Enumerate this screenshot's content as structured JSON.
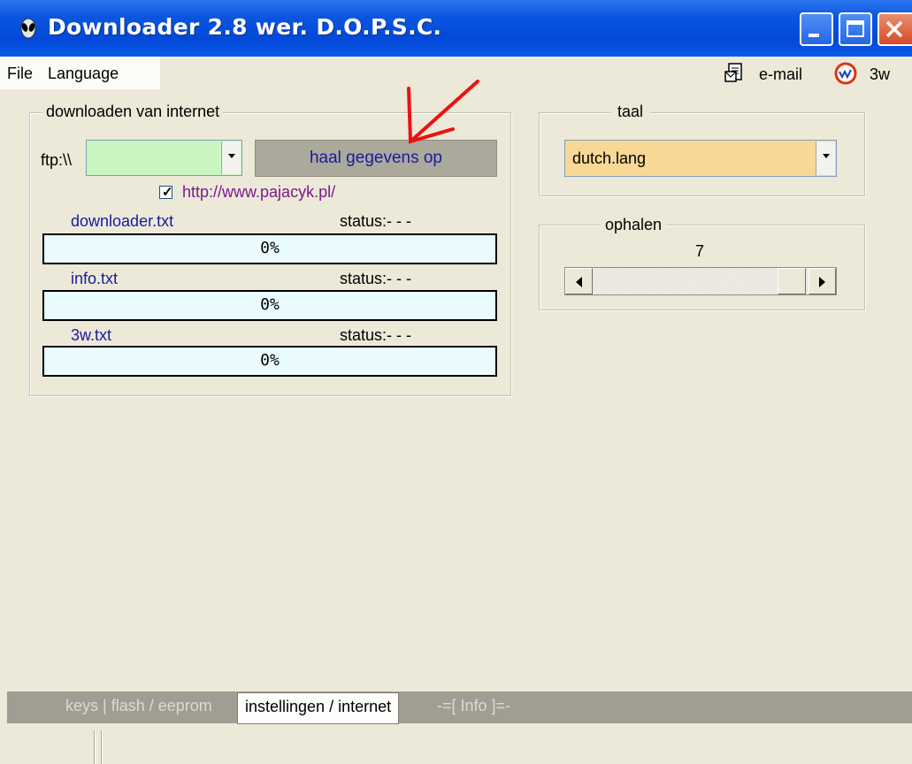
{
  "window": {
    "title": "Downloader 2.8 wer. D.O.P.S.C."
  },
  "menu": {
    "items": [
      "File",
      "Language"
    ],
    "right_items": [
      {
        "label": "e-mail",
        "icon": "email-document-icon"
      },
      {
        "label": "3w",
        "icon": "web-globe-icon"
      }
    ]
  },
  "download_group": {
    "legend": "downloaden van internet",
    "ftp_label": "ftp:\\\\",
    "ftp_value": "",
    "fetch_button": "haal gegevens op",
    "checkbox_checked": true,
    "link_text": "http://www.pajacyk.pl/",
    "files": [
      {
        "name": "downloader.txt",
        "status_label": "status:",
        "status_value": "- - -",
        "progress_text": "0%",
        "progress": 0
      },
      {
        "name": "info.txt",
        "status_label": "status:",
        "status_value": "- - -",
        "progress_text": "0%",
        "progress": 0
      },
      {
        "name": "3w.txt",
        "status_label": "status:",
        "status_value": "- - -",
        "progress_text": "0%",
        "progress": 0
      }
    ]
  },
  "language_group": {
    "legend": "taal",
    "selected": "dutch.lang"
  },
  "retrieve_group": {
    "legend": "ophalen",
    "value": "7"
  },
  "tabs": [
    {
      "label": "keys | flash / eeprom",
      "active": false
    },
    {
      "label": "instellingen / internet",
      "active": true
    },
    {
      "label": "-=[ Info ]=-",
      "active": false
    }
  ],
  "colors": {
    "ftp_input_bg": "#c8f5c0",
    "language_select_bg": "#f8d894",
    "progress_bg": "#e9fbfd",
    "button_bg": "#aba99c",
    "annotation_arrow": "#ee1111"
  }
}
